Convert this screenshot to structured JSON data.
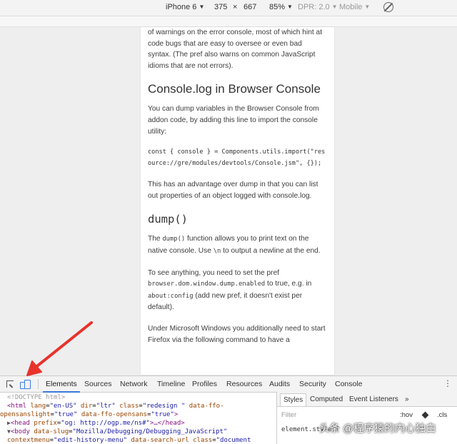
{
  "device_toolbar": {
    "device": "iPhone 6",
    "width": "375",
    "times": "×",
    "height": "667",
    "zoom": "85%",
    "dpr": "DPR: 2.0",
    "mode": "Mobile",
    "rotate_icon": "rotate-icon"
  },
  "article": {
    "intro_partial": "of warnings on the error console, most of which hint at code bugs that are easy to oversee or even bad syntax. (The pref also warns on common JavaScript idioms that are not errors).",
    "h_console": "Console.log in Browser Console",
    "p_console": "You can dump variables in the Browser Console from addon code, by adding this line to import the console utility:",
    "code_import": "const { console } = Components.utils.import(\"resource://gre/modules/devtools/Console.jsm\", {});",
    "p_advantage": "This has an advantage over dump in that you can list out properties of an object logged with console.log.",
    "h_dump": "dump()",
    "p_dump_a": "The ",
    "p_dump_code": "dump()",
    "p_dump_b": " function allows you to print text on the native console. Use ",
    "p_dump_code2": "\\n",
    "p_dump_c": " to output a newline at the end.",
    "p_see_a": "To see anything, you need to set the pref ",
    "p_see_code": "browser.dom.window.dump.enabled",
    "p_see_b": " to true, e.g. in ",
    "p_see_code2": "about:config",
    "p_see_c": " (add new pref, it doesn't exist per default).",
    "p_windows": "Under Microsoft Windows you additionally need to start Firefox via the following command to have a"
  },
  "devtools": {
    "inspect_icon": "inspect-icon",
    "device_icon": "device-mode-icon",
    "tabs": [
      "Elements",
      "Sources",
      "Network",
      "Timeline",
      "Profiles",
      "Resources",
      "Audits",
      "Security",
      "Console"
    ],
    "active_tab": "Elements",
    "more": "⋮",
    "elements": {
      "doctype": "<!DOCTYPE html>",
      "html_open": "<html",
      "attr_lang": "lang",
      "val_lang": "\"en-US\"",
      "attr_dir": "dir",
      "val_dir": "\"ltr\"",
      "attr_class": "class",
      "val_class": "\"redesign \"",
      "attr_ffo": "data-ffo-",
      "attr_ffo2": "opensanslight",
      "val_ffo2": "\"true\"",
      "attr_ffo3": "data-ffo-opensans",
      "val_ffo3": "\"true\"",
      "close_gt": ">",
      "head": "<head",
      "attr_prefix": "prefix",
      "val_prefix": "\"og: http://ogp.me/ns#\"",
      "head_rest": ">…</head>",
      "body": "<body",
      "attr_slug": "data-slug",
      "val_slug": "\"Mozilla/Debugging/Debugging_JavaScript\"",
      "attr_ctx": "contextmenu",
      "val_ctx": "\"edit-history-menu\"",
      "attr_search": "data-search-url",
      "attr_class2": "class",
      "val_class2": "\"document"
    },
    "styles": {
      "tabs": [
        "Styles",
        "Computed",
        "Event Listeners"
      ],
      "more": "»",
      "filter_placeholder": "Filter",
      "hov": ":hov",
      "cls": ".cls",
      "element_style": "element.style {"
    }
  },
  "watermark": "头条 @程序猿的内心独白",
  "colors": {
    "accent": "#3879d9",
    "arrow": "#e8322b"
  }
}
